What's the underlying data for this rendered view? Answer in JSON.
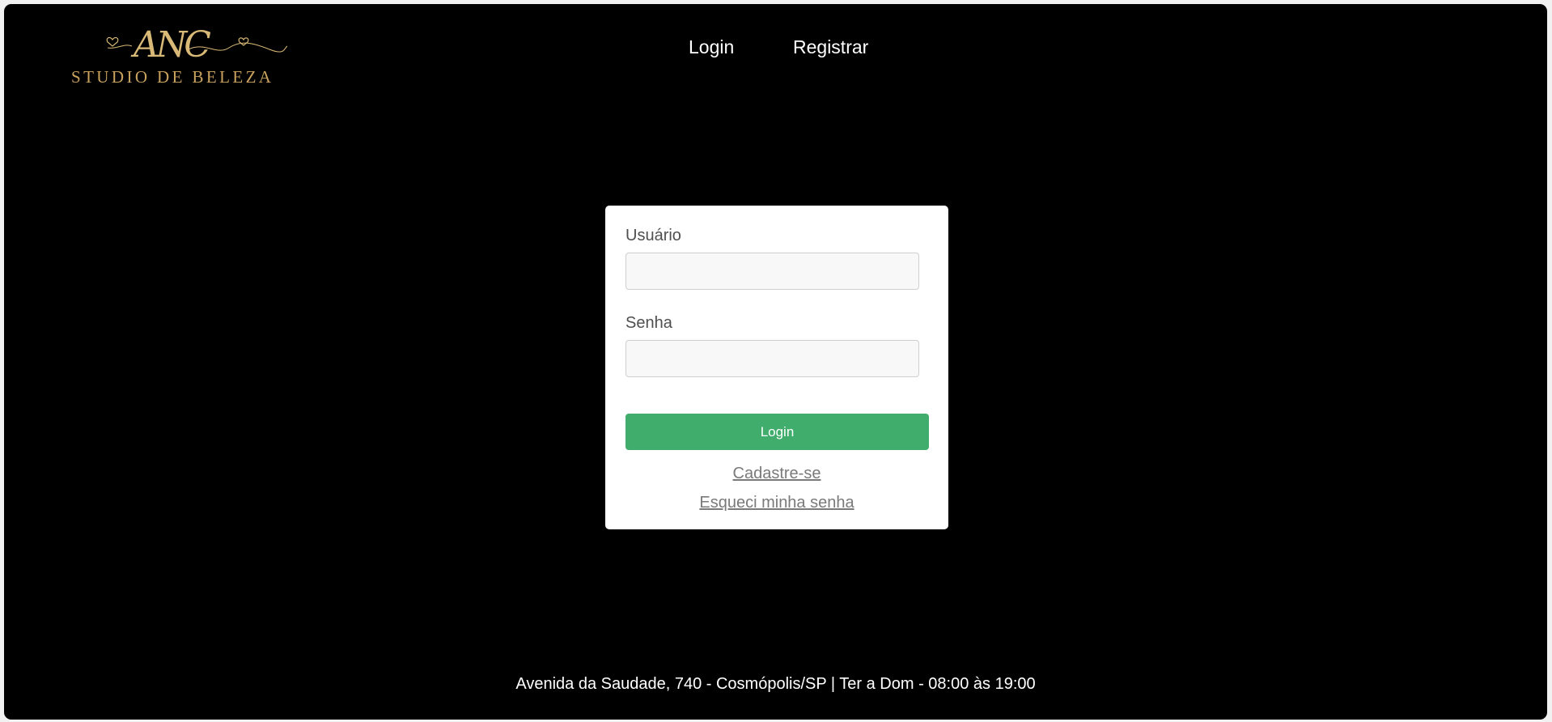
{
  "logo": {
    "monogram": "ANC",
    "subtitle": "STUDIO DE BELEZA",
    "color": "#c9a25e"
  },
  "nav": {
    "login_label": "Login",
    "register_label": "Registrar"
  },
  "login_form": {
    "user_label": "Usuário",
    "user_value": "",
    "password_label": "Senha",
    "password_value": "",
    "submit_label": "Login",
    "register_link": "Cadastre-se",
    "forgot_link": "Esqueci minha senha",
    "submit_color": "#41ad6c"
  },
  "footer": {
    "text": "Avenida da Saudade, 740 - Cosmópolis/SP | Ter a Dom - 08:00 às 19:00"
  }
}
